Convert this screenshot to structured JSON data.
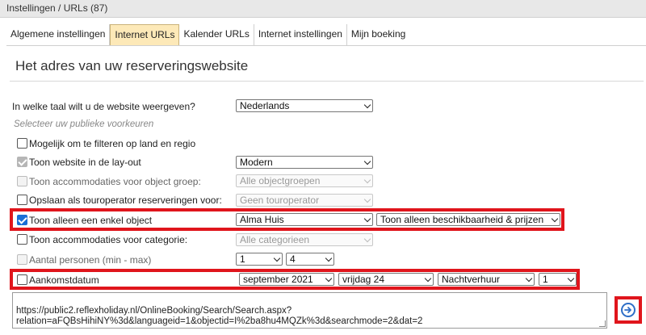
{
  "window": {
    "breadcrumb": "Instellingen / URLs (87)"
  },
  "tabs": [
    {
      "label": "Algemene instellingen",
      "active": false
    },
    {
      "label": "Internet URLs",
      "active": true
    },
    {
      "label": "Kalender URLs",
      "active": false
    },
    {
      "label": "Internet instellingen",
      "active": false
    },
    {
      "label": "Mijn boeking",
      "active": false
    }
  ],
  "page": {
    "title": "Het adres van uw reserveringswebsite"
  },
  "form": {
    "language": {
      "label": "In welke taal wilt u de website weergeven?",
      "value": "Nederlands"
    },
    "preferences_hint": "Selecteer uw publieke voorkeuren",
    "filter_country": {
      "label": "Mogelijk om te filteren op land en regio",
      "checked": false
    },
    "layout": {
      "label": "Toon website in de lay-out",
      "checked": true,
      "disabled": true,
      "value": "Modern"
    },
    "object_group": {
      "label": "Toon accommodaties voor object groep:",
      "checked": false,
      "disabled": true,
      "value": "Alle objectgroepen"
    },
    "touroperator": {
      "label": "Opslaan als touroperator reserveringen voor:",
      "checked": false,
      "value": "Geen touroperator"
    },
    "single_object": {
      "label": "Toon alleen een enkel object",
      "checked": true,
      "value": "Alma Huis",
      "mode": "Toon alleen beschikbaarheid & prijzen"
    },
    "category": {
      "label": "Toon accommodaties voor categorie:",
      "checked": false,
      "value": "Alle categorieen"
    },
    "persons": {
      "label": "Aantal personen (min - max)",
      "checked": false,
      "disabled": true,
      "min": "1",
      "max": "4"
    },
    "arrival": {
      "label": "Aankomstdatum",
      "checked": false,
      "month": "september 2021",
      "day": "vrijdag 24",
      "type": "Nachtverhuur",
      "nights": "1"
    }
  },
  "url": {
    "value": "https://public2.reflexholiday.nl/OnlineBooking/Search/Search.aspx?\nrelation=aFQBsHihiNY%3d&languageid=1&objectid=I%2ba8hu4MQZk%3d&searchmode=2&dat=2"
  },
  "colors": {
    "highlight": "#e0151c",
    "active_tab": "#fde9b8",
    "go_button": "#2f6fc7"
  }
}
